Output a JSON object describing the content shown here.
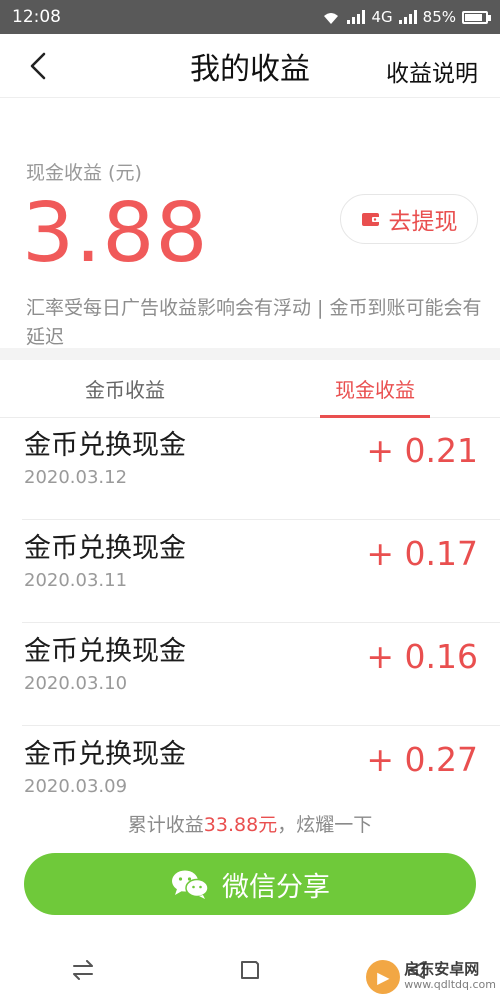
{
  "status_bar": {
    "time": "12:08",
    "network": "4G",
    "battery": "85%",
    "battery_level": 0.85
  },
  "nav": {
    "title": "我的收益",
    "right_label": "收益说明"
  },
  "hero": {
    "label": "现金收益 (元)",
    "amount": "3.88",
    "withdraw_label": "去提现",
    "note": "汇率受每日广告收益影响会有浮动 | 金币到账可能会有延迟"
  },
  "tabs": [
    {
      "label": "金币收益",
      "active": false
    },
    {
      "label": "现金收益",
      "active": true
    }
  ],
  "records": [
    {
      "title": "金币兑换现金",
      "date": "2020.03.12",
      "amount": "+ 0.21"
    },
    {
      "title": "金币兑换现金",
      "date": "2020.03.11",
      "amount": "+ 0.17"
    },
    {
      "title": "金币兑换现金",
      "date": "2020.03.10",
      "amount": "+ 0.16"
    },
    {
      "title": "金币兑换现金",
      "date": "2020.03.09",
      "amount": "+ 0.27"
    }
  ],
  "footer": {
    "prefix": "累计收益",
    "total": "33.88元",
    "suffix": "，炫耀一下"
  },
  "share": {
    "label": "微信分享"
  },
  "watermark": {
    "name": "启东安卓网",
    "url": "www.qdltdq.com"
  },
  "colors": {
    "accent": "#e94f4f",
    "share_green": "#6fc93a"
  }
}
